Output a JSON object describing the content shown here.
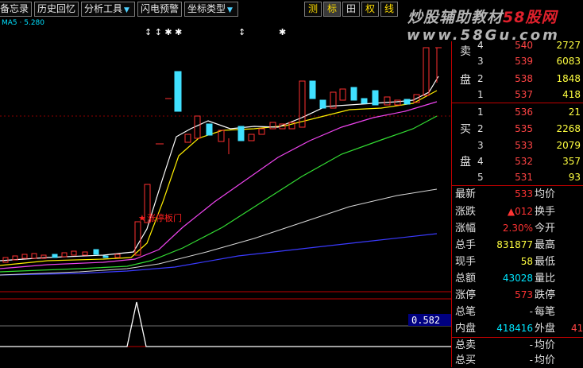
{
  "toolbar": {
    "memo": "备忘录",
    "history": "历史回忆",
    "analysis": "分析工具",
    "flash": "闪电预警",
    "coord": "坐标类型",
    "btn_measure": "测",
    "btn_mark": "标",
    "btn_grid": "田",
    "btn_rights": "权",
    "btn_line": "线"
  },
  "watermark": {
    "part1": "炒股辅助教材",
    "part2": "58股网",
    "url": "www.58Gu.com"
  },
  "chart": {
    "marker_label": "涨停板门",
    "indicator_value": "0.582"
  },
  "orderbook": {
    "sell_label_1": "卖",
    "sell_label_2": "盘",
    "buy_label_1": "买",
    "buy_label_2": "盘",
    "sells": [
      {
        "level": "4",
        "price": "540",
        "volume": "2727"
      },
      {
        "level": "3",
        "price": "539",
        "volume": "6083"
      },
      {
        "level": "2",
        "price": "538",
        "volume": "1848"
      },
      {
        "level": "1",
        "price": "537",
        "volume": "418"
      }
    ],
    "buys": [
      {
        "level": "1",
        "price": "536",
        "volume": "21"
      },
      {
        "level": "2",
        "price": "535",
        "volume": "2268"
      },
      {
        "level": "3",
        "price": "533",
        "volume": "2079"
      },
      {
        "level": "4",
        "price": "532",
        "volume": "357"
      },
      {
        "level": "5",
        "price": "531",
        "volume": "93"
      }
    ]
  },
  "quote": {
    "latest_label": "最新",
    "latest": "533",
    "avg_label": "均价",
    "change_label": "涨跌",
    "change": "▲012",
    "turnover_label": "换手",
    "pct_label": "涨幅",
    "pct": "2.30%",
    "open_label": "今开",
    "total_label": "总手",
    "total": "831877",
    "high_label": "最高",
    "now_label": "现手",
    "now": "58",
    "low_label": "最低",
    "amount_label": "总额",
    "amount": "43028",
    "vratio_label": "量比",
    "limitup_label": "涨停",
    "limitup": "573",
    "limitdown_label": "跌停",
    "trades_label": "总笔",
    "trades": "-",
    "pertrade_label": "每笔",
    "inner_label": "内盘",
    "inner": "418416",
    "outer_label": "外盘",
    "outer": "41",
    "totalsell_label": "总卖",
    "totalsell": "-",
    "avg2_label": "均价",
    "totalbuy_label": "总买",
    "totalbuy": "-",
    "avg3_label": "均价"
  }
}
